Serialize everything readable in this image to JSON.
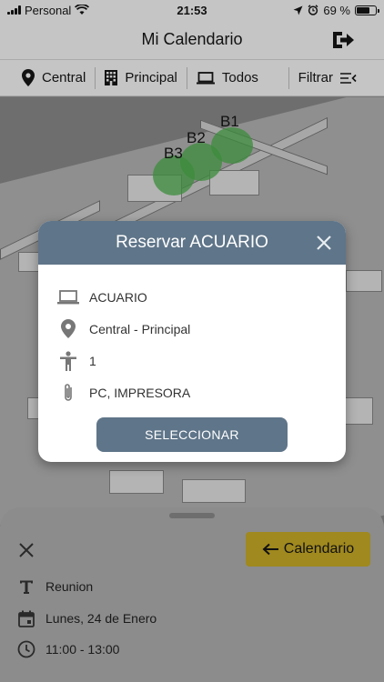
{
  "status_bar": {
    "carrier": "Personal",
    "time": "21:53",
    "battery_text": "69 %",
    "battery_level": 0.69
  },
  "header": {
    "title": "Mi Calendario",
    "logout_icon": "logout-icon"
  },
  "filters": {
    "location": "Central",
    "building": "Principal",
    "device": "Todos",
    "filter_label": "Filtrar"
  },
  "map": {
    "seat_labels": [
      "B1",
      "B2",
      "B3"
    ],
    "glow_color": "#3c8c3c"
  },
  "modal": {
    "title": "Reservar ACUARIO",
    "resource": "ACUARIO",
    "location": "Central - Principal",
    "capacity": "1",
    "equipment": "PC, IMPRESORA",
    "select_label": "SELECCIONAR",
    "header_color": "#5f7589"
  },
  "sheet": {
    "calendar_label": "Calendario",
    "subject": "Reunion",
    "date": "Lunes, 24 de Enero",
    "time_range": "11:00 - 13:00",
    "accent_color": "#a0891e"
  }
}
